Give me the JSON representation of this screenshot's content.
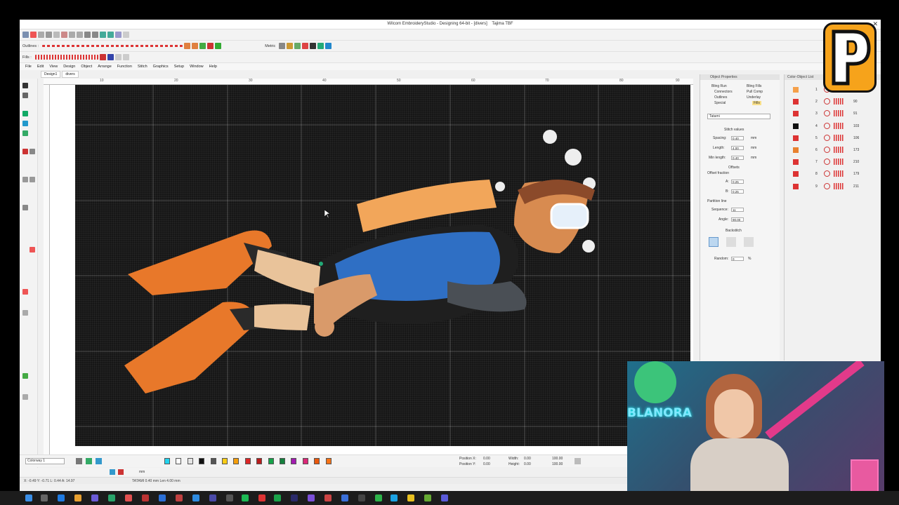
{
  "window": {
    "title": "Wilcom EmbroideryStudio - Designing 64-bit - [divers]",
    "machine": "Tajima TBF",
    "close": "✕"
  },
  "toolbar": {
    "outlines_label": "Outlines :",
    "fills_label": "Fills :",
    "units": "Metric"
  },
  "menu": [
    "File",
    "Edit",
    "View",
    "Design",
    "Object",
    "Arrange",
    "Function",
    "Stitch",
    "Graphics",
    "Setup",
    "Window",
    "Help"
  ],
  "doc_tabs": [
    "Design1",
    "divers"
  ],
  "rulers": {
    "h": [
      "10",
      "20",
      "30",
      "40",
      "50",
      "60",
      "70",
      "80",
      "90"
    ]
  },
  "object_properties": {
    "title": "Object Properties",
    "tabs": [
      "Bling Run",
      "Bling Fills",
      "Connectors",
      "Pull Comp",
      "Outlines",
      "Underlay",
      "Special",
      "Fills"
    ],
    "fill_type": "Tatami",
    "section": "Stitch values",
    "spacing_label": "Spacing:",
    "spacing": "0.40",
    "length_label": "Length:",
    "length": "4.00",
    "min_length_label": "Min length:",
    "min_length": "0.40",
    "unit": "mm",
    "offsets_label": "Offsets",
    "offset_fraction_label": "Offset fraction",
    "a_label": "A:",
    "a": "0.25",
    "b_label": "B:",
    "b": "0.25",
    "partition_line_label": "Partition line",
    "sequence_label": "Sequence:",
    "sequence": "11",
    "angle_label": "Angle:",
    "angle": "90.00",
    "backstitch_label": "Backstitch",
    "random_label": "Random:",
    "random": "0",
    "percent": "%"
  },
  "color_object_list": {
    "title": "Color-Object List",
    "rows": [
      {
        "n": "1",
        "v": "",
        "color": "#f5a04a"
      },
      {
        "n": "2",
        "v": "90",
        "color": "#d33"
      },
      {
        "n": "3",
        "v": "91",
        "color": "#d33"
      },
      {
        "n": "4",
        "v": "103",
        "color": "#111"
      },
      {
        "n": "5",
        "v": "106",
        "color": "#d33"
      },
      {
        "n": "6",
        "v": "173",
        "color": "#e8812f"
      },
      {
        "n": "7",
        "v": "210",
        "color": "#d33"
      },
      {
        "n": "8",
        "v": "179",
        "color": "#d33"
      },
      {
        "n": "9",
        "v": "211",
        "color": "#d33"
      }
    ]
  },
  "bottom": {
    "colorway": "Colorway 1",
    "position_x_label": "Position X:",
    "position_y_label": "Position Y:",
    "width_label": "Width:",
    "height_label": "Height:",
    "pos_x": "0.00",
    "pos_y": "0.00",
    "width": "0.00",
    "height": "0.00",
    "pct_w": "100.00",
    "pct_h": "100.00",
    "swatches": [
      "#22d3ee",
      "#ffffff",
      "#e5e5e5",
      "#111111",
      "#555555",
      "#facc15",
      "#f59e0b",
      "#dc2626",
      "#b91c1c",
      "#16a34a",
      "#15803d",
      "#a21caf",
      "#db2777",
      "#ea580c",
      "#f97316"
    ]
  },
  "status": {
    "left": "X: -0.49  Y: -0.71  L: 0.44 A: 14.97",
    "right": "TATAMI  0.40 mm  Len 4.00 mm",
    "unit_field": "mm"
  },
  "webcam": {
    "sign_text": "BLANORA"
  },
  "colors": {
    "hoop": "#161616",
    "accent": "#f6a31b"
  }
}
